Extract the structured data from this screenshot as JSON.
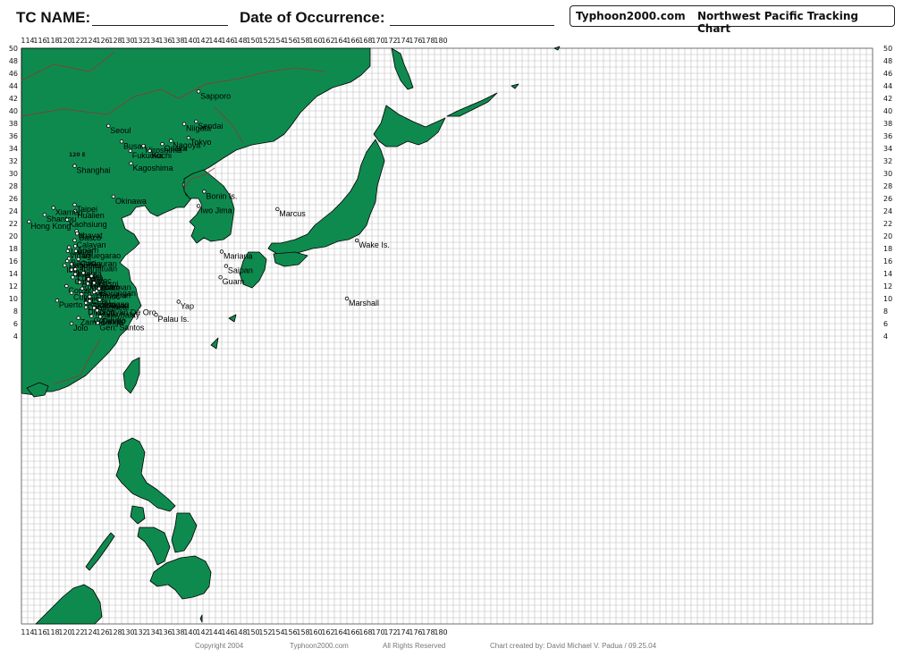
{
  "header": {
    "tc_name_label": "TC NAME:",
    "date_label": "Date of Occurrence:",
    "site": "Typhoon2000.com",
    "chart_title": "Northwest Pacific Tracking Chart"
  },
  "axes": {
    "lon_labels": [
      "114",
      "116",
      "118",
      "120",
      "122",
      "124",
      "126",
      "128",
      "130",
      "132",
      "134",
      "136",
      "138",
      "140",
      "142",
      "144",
      "146",
      "148",
      "150",
      "152",
      "154",
      "156",
      "158",
      "160",
      "162",
      "164",
      "166",
      "168",
      "170",
      "172",
      "174",
      "176",
      "178",
      "180"
    ],
    "lat_labels": [
      "50",
      "48",
      "46",
      "44",
      "42",
      "40",
      "38",
      "36",
      "34",
      "32",
      "30",
      "28",
      "26",
      "24",
      "22",
      "20",
      "18",
      "16",
      "14",
      "12",
      "10",
      "8",
      "6",
      "4"
    ],
    "reference_label": "120 E"
  },
  "colors": {
    "land": "#0f8a4f",
    "grid": "#bdbdbd",
    "border": "#8b3a2a",
    "coast": "#000000"
  },
  "places": [
    {
      "name": "Sapporo",
      "lon": 141.3,
      "lat": 43.1
    },
    {
      "name": "Sendai",
      "lon": 140.9,
      "lat": 38.3
    },
    {
      "name": "Niigata",
      "lon": 139.0,
      "lat": 37.9
    },
    {
      "name": "Seoul",
      "lon": 126.9,
      "lat": 37.6
    },
    {
      "name": "Tokyo",
      "lon": 139.7,
      "lat": 35.7
    },
    {
      "name": "Osaka",
      "lon": 135.5,
      "lat": 34.7
    },
    {
      "name": "Nagoya",
      "lon": 136.9,
      "lat": 35.2
    },
    {
      "name": "Busan",
      "lon": 129.0,
      "lat": 35.1
    },
    {
      "name": "Hiroshima",
      "lon": 132.5,
      "lat": 34.4
    },
    {
      "name": "Fukuoka",
      "lon": 130.4,
      "lat": 33.6
    },
    {
      "name": "Kochi",
      "lon": 133.5,
      "lat": 33.6
    },
    {
      "name": "Kagoshima",
      "lon": 130.5,
      "lat": 31.6
    },
    {
      "name": "Shanghai",
      "lon": 121.5,
      "lat": 31.2
    },
    {
      "name": "Okinawa",
      "lon": 127.7,
      "lat": 26.3
    },
    {
      "name": "Bonin Is.",
      "lon": 142.2,
      "lat": 27.1
    },
    {
      "name": "Iwo Jima",
      "lon": 141.3,
      "lat": 24.8
    },
    {
      "name": "Marcus",
      "lon": 153.9,
      "lat": 24.3
    },
    {
      "name": "Taipei",
      "lon": 121.5,
      "lat": 25.0
    },
    {
      "name": "Hualien",
      "lon": 121.6,
      "lat": 24.0
    },
    {
      "name": "Xiamen",
      "lon": 118.1,
      "lat": 24.5
    },
    {
      "name": "Shantou",
      "lon": 116.7,
      "lat": 23.4
    },
    {
      "name": "Kaohsiung",
      "lon": 120.3,
      "lat": 22.6
    },
    {
      "name": "Hong Kong",
      "lon": 114.2,
      "lat": 22.3
    },
    {
      "name": "Itbayat",
      "lon": 121.8,
      "lat": 20.8
    },
    {
      "name": "Basco",
      "lon": 121.9,
      "lat": 20.4
    },
    {
      "name": "Calayan",
      "lon": 121.5,
      "lat": 19.3
    },
    {
      "name": "Aparri",
      "lon": 121.6,
      "lat": 18.4
    },
    {
      "name": "Laoag",
      "lon": 120.6,
      "lat": 18.2
    },
    {
      "name": "Vigan",
      "lon": 120.4,
      "lat": 17.6
    },
    {
      "name": "Tuguegarao",
      "lon": 121.7,
      "lat": 17.6
    },
    {
      "name": "Baguio",
      "lon": 120.6,
      "lat": 16.4
    },
    {
      "name": "Casiguran",
      "lon": 122.1,
      "lat": 16.3
    },
    {
      "name": "Dagupan",
      "lon": 120.3,
      "lat": 16.0
    },
    {
      "name": "Cabanatuan",
      "lon": 121.0,
      "lat": 15.5
    },
    {
      "name": "Iba",
      "lon": 119.9,
      "lat": 15.3
    },
    {
      "name": "Manila",
      "lon": 121.0,
      "lat": 14.6
    },
    {
      "name": "Infanta",
      "lon": 121.6,
      "lat": 14.7
    },
    {
      "name": "Lucena",
      "lon": 121.6,
      "lat": 13.9
    },
    {
      "name": "Daet",
      "lon": 122.9,
      "lat": 14.1
    },
    {
      "name": "Virac",
      "lon": 124.2,
      "lat": 13.6
    },
    {
      "name": "Calapan",
      "lon": 121.2,
      "lat": 13.4
    },
    {
      "name": "Legaspi",
      "lon": 123.7,
      "lat": 13.1
    },
    {
      "name": "Romblon",
      "lon": 122.3,
      "lat": 12.6
    },
    {
      "name": "Catarman",
      "lon": 124.6,
      "lat": 12.5
    },
    {
      "name": "Coron",
      "lon": 120.2,
      "lat": 12.0
    },
    {
      "name": "Masbate",
      "lon": 123.6,
      "lat": 12.4
    },
    {
      "name": "Roxas",
      "lon": 122.7,
      "lat": 11.6
    },
    {
      "name": "Tacloban",
      "lon": 125.0,
      "lat": 11.2
    },
    {
      "name": "Borongan",
      "lon": 125.4,
      "lat": 11.6
    },
    {
      "name": "Iloilo",
      "lon": 122.6,
      "lat": 10.7
    },
    {
      "name": "Cuyo",
      "lon": 121.0,
      "lat": 10.9
    },
    {
      "name": "Ormoc",
      "lon": 124.6,
      "lat": 11.0
    },
    {
      "name": "Cebu",
      "lon": 123.9,
      "lat": 10.3
    },
    {
      "name": "Puerto Princesa",
      "lon": 118.7,
      "lat": 9.7
    },
    {
      "name": "Tagbilaran",
      "lon": 123.9,
      "lat": 9.6
    },
    {
      "name": "Dumaguete",
      "lon": 123.3,
      "lat": 9.3
    },
    {
      "name": "Surigao",
      "lon": 125.5,
      "lat": 9.8
    },
    {
      "name": "Dipolog",
      "lon": 123.3,
      "lat": 8.6
    },
    {
      "name": "Cagayan De Oro",
      "lon": 124.6,
      "lat": 8.5
    },
    {
      "name": "Malaybalay",
      "lon": 125.1,
      "lat": 8.1
    },
    {
      "name": "Zamboanga",
      "lon": 122.1,
      "lat": 6.9
    },
    {
      "name": "Cotabato",
      "lon": 124.2,
      "lat": 7.2
    },
    {
      "name": "Davao",
      "lon": 125.6,
      "lat": 7.1
    },
    {
      "name": "Jolo",
      "lon": 121.0,
      "lat": 6.0
    },
    {
      "name": "Gen. Santos",
      "lon": 125.2,
      "lat": 6.1
    },
    {
      "name": "Palau Is.",
      "lon": 134.5,
      "lat": 7.4
    },
    {
      "name": "Yap",
      "lon": 138.1,
      "lat": 9.5
    },
    {
      "name": "Mariana",
      "lon": 145.0,
      "lat": 17.5
    },
    {
      "name": "Saipan",
      "lon": 145.7,
      "lat": 15.2
    },
    {
      "name": "Guam",
      "lon": 144.8,
      "lat": 13.4
    },
    {
      "name": "Wake Is.",
      "lon": 166.6,
      "lat": 19.3
    },
    {
      "name": "Marshall",
      "lon": 165.0,
      "lat": 10.0
    }
  ],
  "footer": {
    "copyright": "Copyright 2004",
    "site": "Typhoon2000.com",
    "rights": "All Rights Reserved",
    "credit": "Chart created by:   David Michael V. Padua / 09.25.04"
  }
}
